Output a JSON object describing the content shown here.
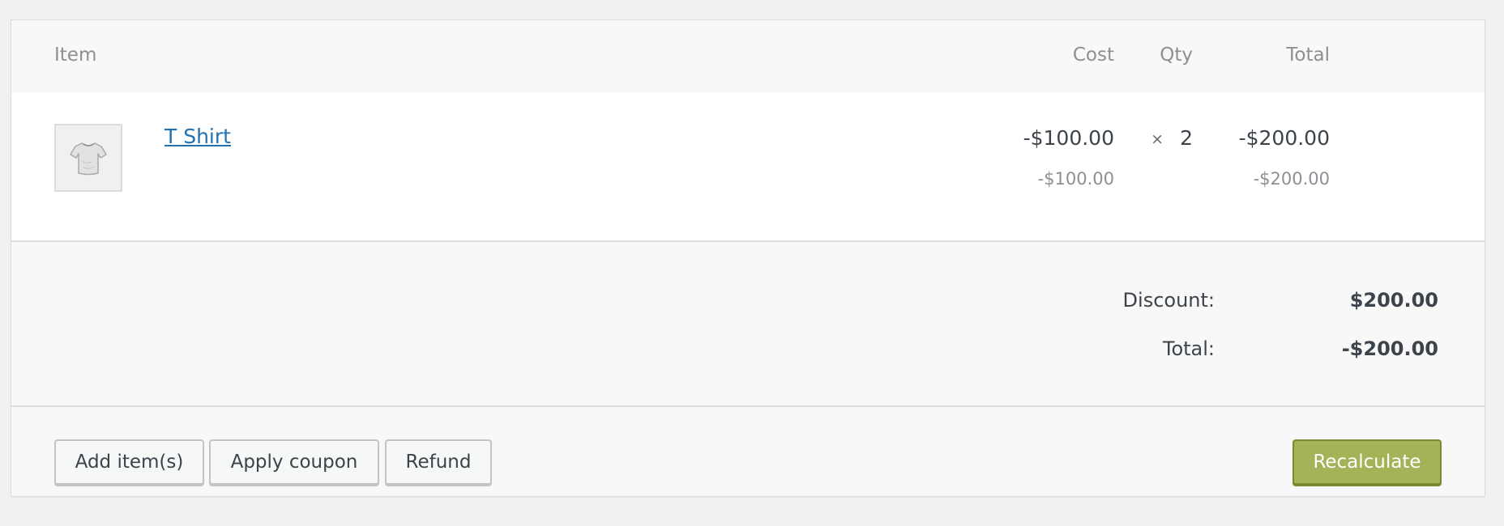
{
  "table": {
    "headers": {
      "item": "Item",
      "cost": "Cost",
      "qty": "Qty",
      "total": "Total"
    }
  },
  "line_item": {
    "image": "t-shirt-thumbnail",
    "name": "T Shirt",
    "cost": "-$100.00",
    "cost_sub": "-$100.00",
    "qty_symbol": "×",
    "qty": "2",
    "total": "-$200.00",
    "total_sub": "-$200.00"
  },
  "totals": {
    "discount_label": "Discount:",
    "discount_value": "$200.00",
    "total_label": "Total:",
    "total_value": "-$200.00"
  },
  "actions": {
    "add_items": "Add item(s)",
    "apply_coupon": "Apply coupon",
    "refund": "Refund",
    "recalculate": "Recalculate"
  },
  "colors": {
    "link": "#2271b1",
    "primary_button": "#a4b357"
  }
}
